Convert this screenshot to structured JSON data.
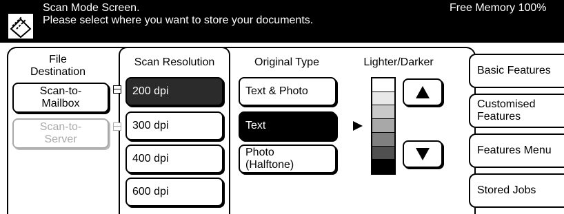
{
  "header": {
    "line1": "Scan Mode Screen.",
    "line2": "Please select where you want to store your documents.",
    "free_memory": "Free Memory  100%",
    "icon": "scanner-icon"
  },
  "columns": {
    "file_destination": "File\nDestination",
    "scan_resolution": "Scan Resolution",
    "original_type": "Original Type",
    "lighter_darker": "Lighter/Darker"
  },
  "file_destination": {
    "mailbox": "Scan-to-\nMailbox",
    "server": "Scan-to-\nServer",
    "server_disabled": true
  },
  "scan_resolution": {
    "options": [
      "200 dpi",
      "300 dpi",
      "400 dpi",
      "600 dpi"
    ],
    "selected": "200 dpi"
  },
  "original_type": {
    "options": [
      "Text & Photo",
      "Text",
      "Photo\n(Halftone)"
    ],
    "selected": "Text"
  },
  "lighter_darker": {
    "level": 4,
    "of": 7,
    "up_icon": "triangle-up-icon",
    "down_icon": "triangle-down-icon"
  },
  "side_tabs": {
    "basic": "Basic Features",
    "custom": "Customised\nFeatures",
    "menu": "Features Menu",
    "stored": "Stored Jobs"
  },
  "colors": {
    "header_bg": "#000000",
    "selected_bg": "#2b2b2b",
    "disabled": "#aaaaaa"
  }
}
